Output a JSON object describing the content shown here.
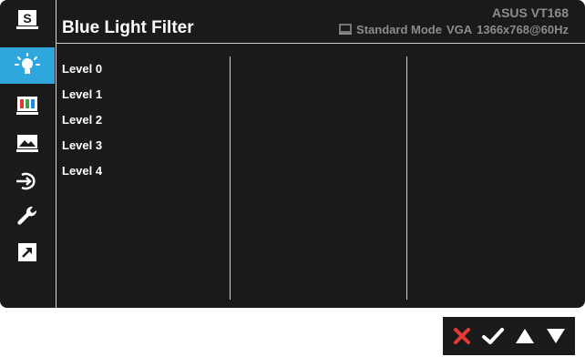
{
  "header": {
    "title": "Blue Light Filter",
    "model": "ASUS VT168",
    "mode": "Standard Mode",
    "input": "VGA",
    "resolution": "1366x768@60Hz"
  },
  "sidebar": {
    "items": [
      {
        "icon": "splendid-icon",
        "label": "S"
      },
      {
        "icon": "blue-light-icon"
      },
      {
        "icon": "color-icon"
      },
      {
        "icon": "image-icon"
      },
      {
        "icon": "input-select-icon"
      },
      {
        "icon": "system-setup-icon"
      },
      {
        "icon": "shortcut-icon"
      }
    ],
    "active": 1
  },
  "levels": [
    "Level 0",
    "Level 1",
    "Level 2",
    "Level 3",
    "Level 4"
  ],
  "keys": [
    {
      "icon": "close-icon"
    },
    {
      "icon": "check-icon"
    },
    {
      "icon": "up-icon"
    },
    {
      "icon": "down-icon"
    }
  ],
  "colors": {
    "accent": "#2ea8dc",
    "panel": "#1a1a1a",
    "close": "#e53935"
  }
}
